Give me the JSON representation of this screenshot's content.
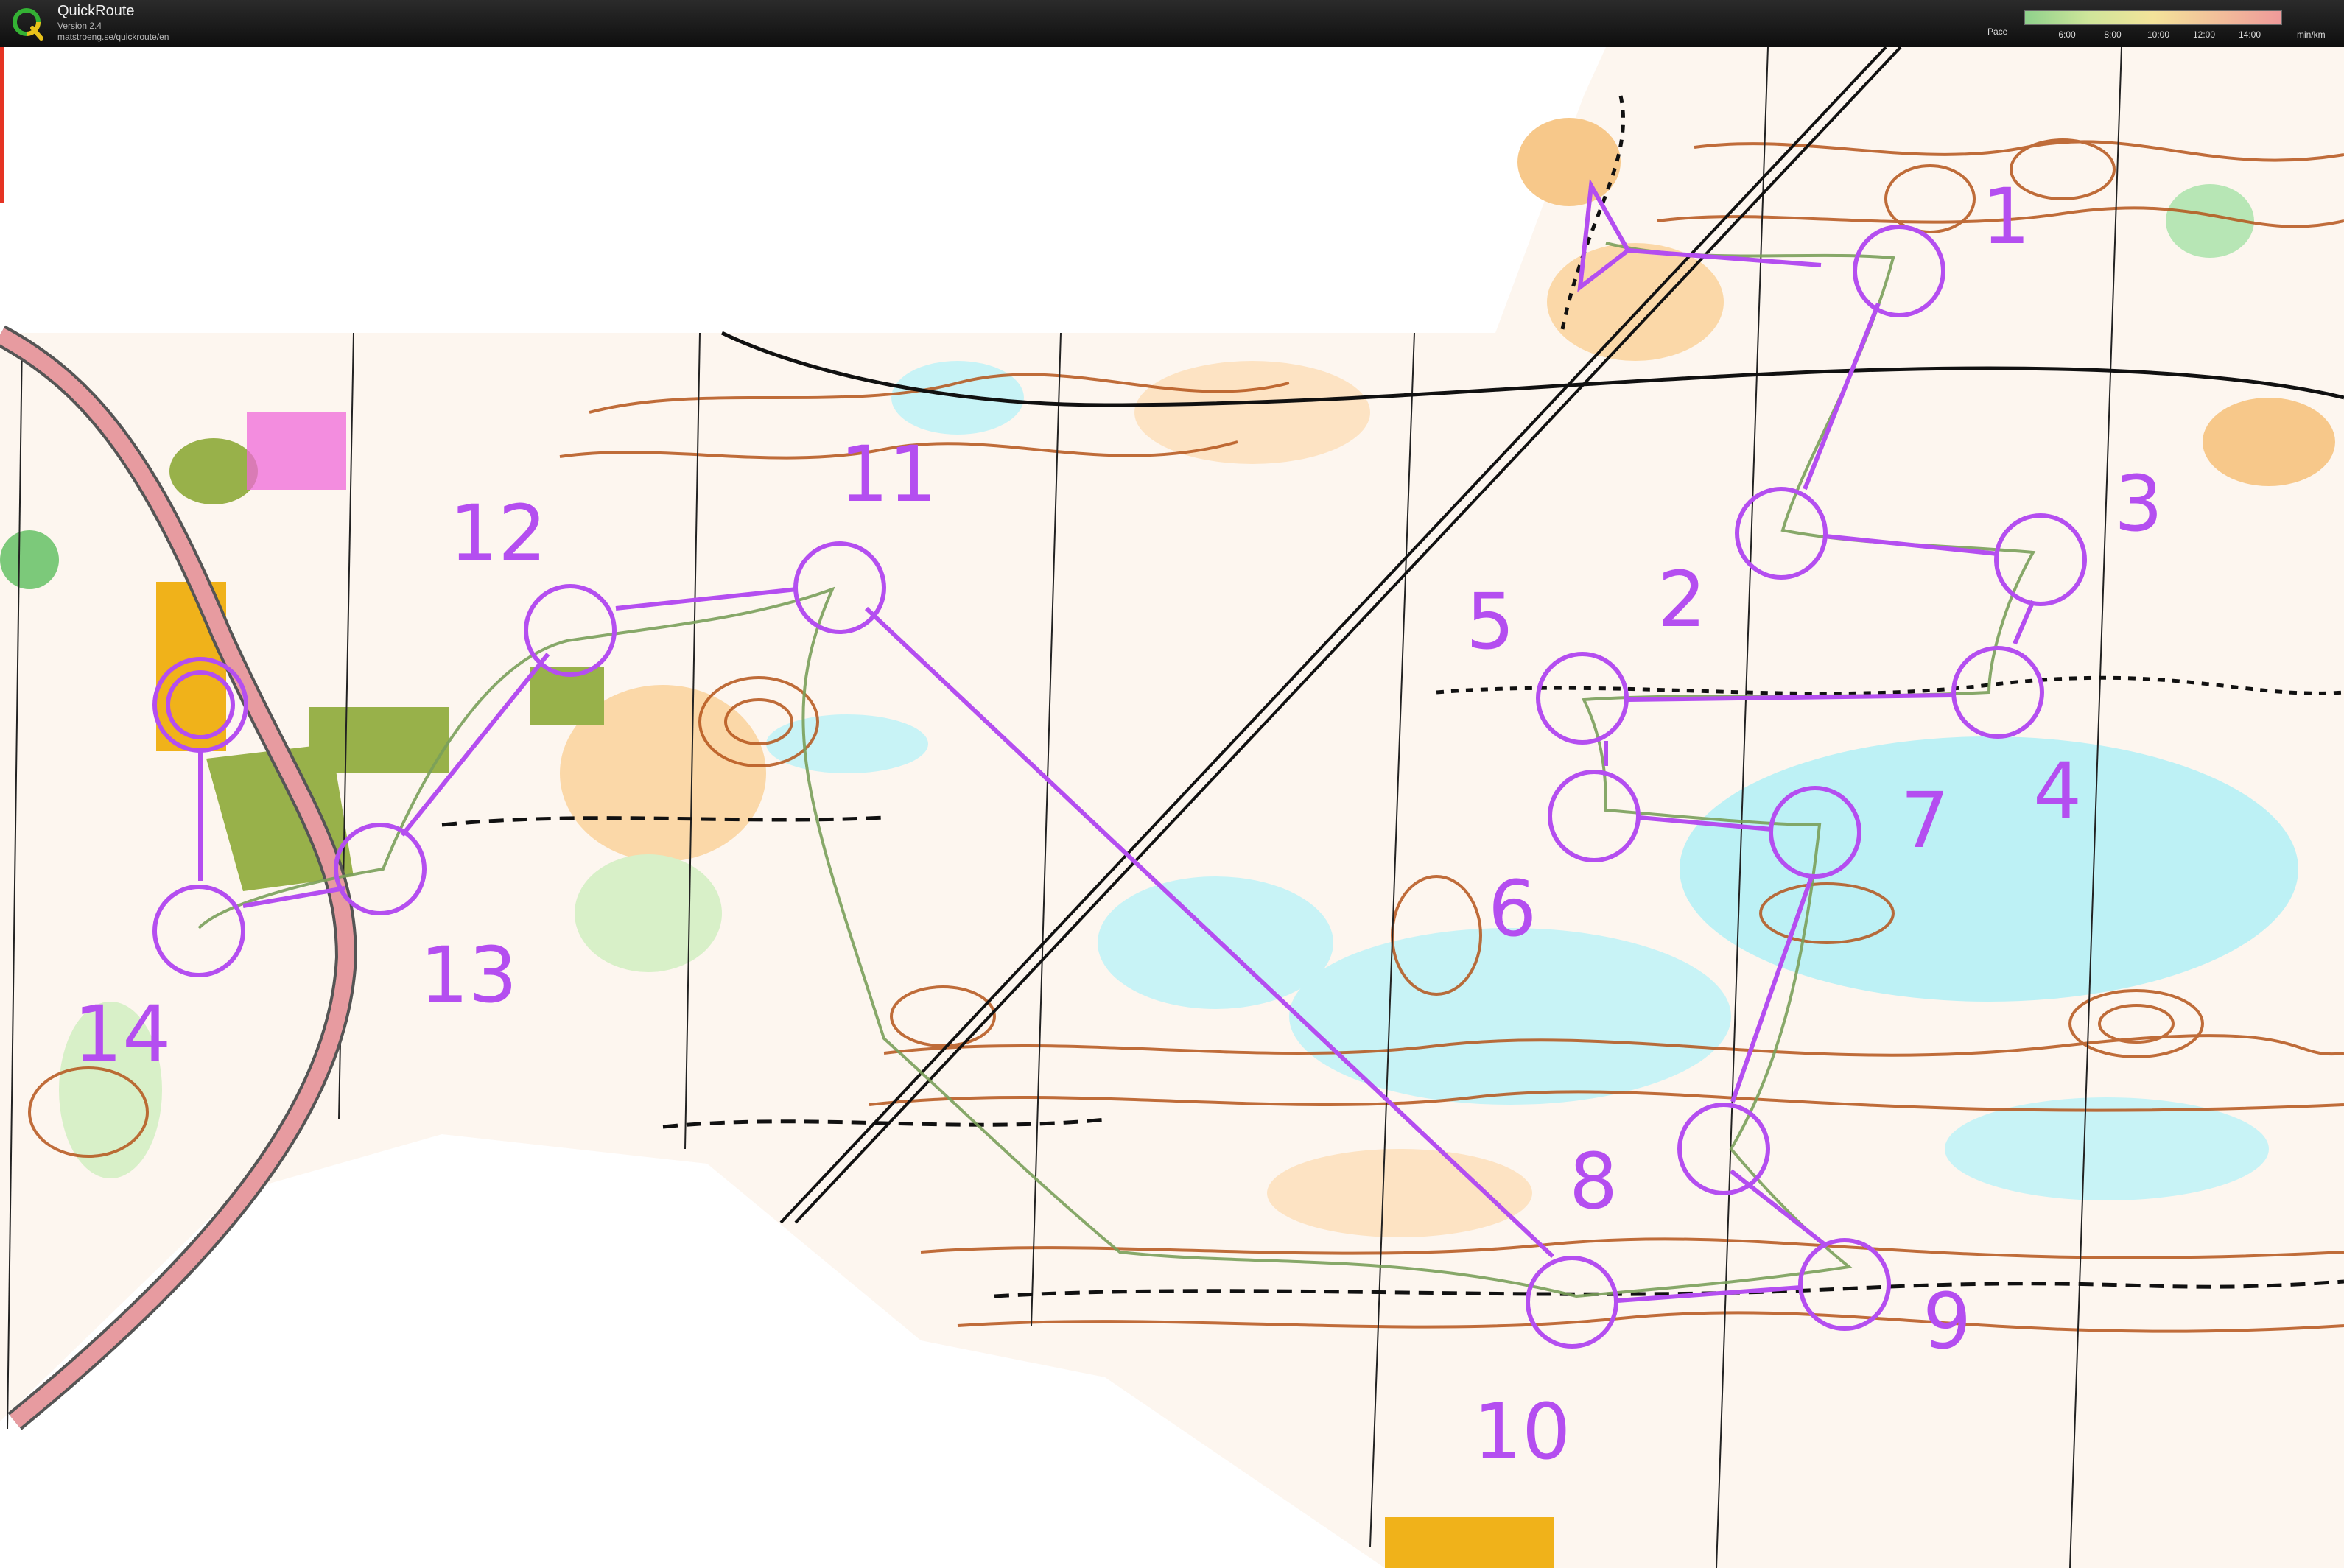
{
  "app": {
    "title": "QuickRoute",
    "version": "Version 2.4",
    "url": "matstroeng.se/quickroute/en",
    "logo_icon": "quickroute-q-logo"
  },
  "pace_legend": {
    "label": "Pace",
    "ticks": [
      "6:00",
      "8:00",
      "10:00",
      "12:00",
      "14:00"
    ],
    "unit": "min/km"
  },
  "course": {
    "color": "#b44ef0",
    "start_icon": "start-triangle",
    "finish_icon": "finish-double-circle",
    "controls": [
      "1",
      "2",
      "3",
      "4",
      "5",
      "6",
      "7",
      "8",
      "9",
      "10",
      "11",
      "12",
      "13",
      "14"
    ]
  },
  "colors": {
    "contour": "#b5541a",
    "marsh": "#3fd6e0",
    "open_land": "#f7c88a",
    "field": "#f0b21a",
    "green": "#7cc97a",
    "road": "#e79ba0",
    "route": "#7aa05a"
  }
}
